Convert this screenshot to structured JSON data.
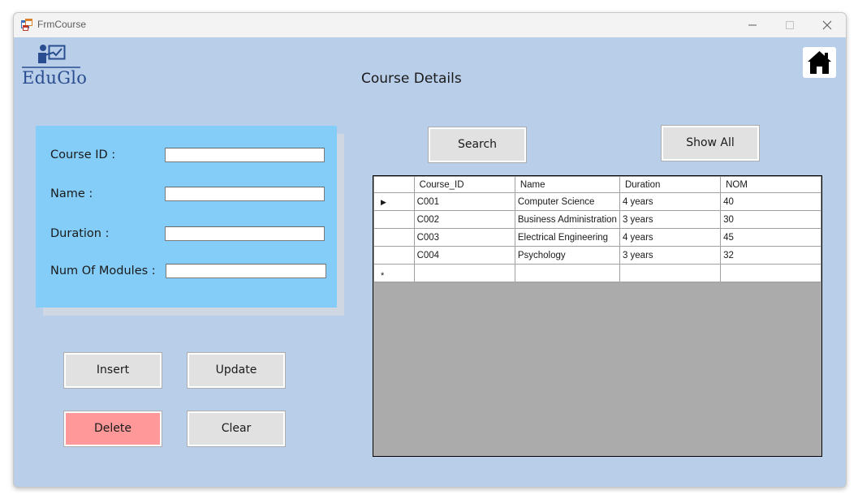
{
  "window": {
    "title": "FrmCourse"
  },
  "logo": {
    "text": "EduGlo"
  },
  "page_title": "Course Details",
  "form": {
    "course_id_label": "Course ID :",
    "name_label": "Name :",
    "duration_label": "Duration :",
    "modules_label": "Num Of Modules :",
    "course_id_value": "",
    "name_value": "",
    "duration_value": "",
    "modules_value": ""
  },
  "buttons": {
    "search": "Search",
    "show_all": "Show All",
    "insert": "Insert",
    "update": "Update",
    "delete": "Delete",
    "clear": "Clear"
  },
  "grid": {
    "columns": [
      "Course_ID",
      "Name",
      "Duration",
      "NOM"
    ],
    "rows": [
      [
        "C001",
        "Computer Science",
        "4 years",
        "40"
      ],
      [
        "C002",
        "Business Administration",
        "3 years",
        "30"
      ],
      [
        "C003",
        "Electrical Engineering",
        "4 years",
        "45"
      ],
      [
        "C004",
        "Psychology",
        "3 years",
        "32"
      ]
    ],
    "current_row_marker": "▶",
    "new_row_marker": "*"
  },
  "colors": {
    "window_bg": "#b9cfe9",
    "panel_bg": "#85cdf9",
    "delete_button": "#ff9999",
    "grid_bg": "#ababab",
    "logo_blue": "#2a4d91"
  },
  "icons": {
    "app": "app-form-icon",
    "minimize": "minimize-icon",
    "maximize": "maximize-icon",
    "close": "close-icon",
    "home": "home-icon",
    "logo": "teacher-board-icon"
  }
}
